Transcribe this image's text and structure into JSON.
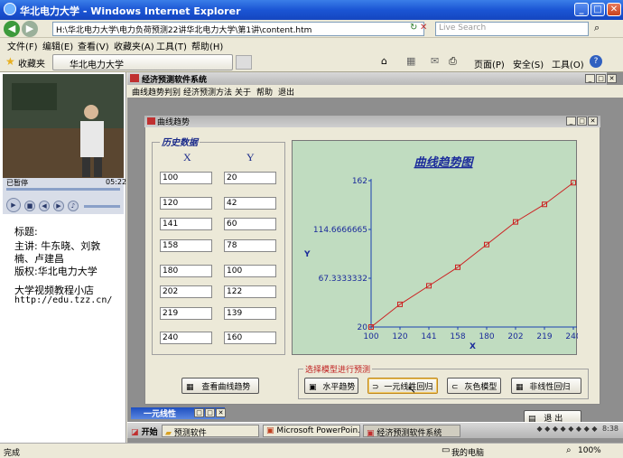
{
  "ie": {
    "title": "华北电力大学 - Windows Internet Explorer",
    "address": "H:\\华北电力大学\\电力负荷预测22讲华北电力大学\\第1讲\\content.htm",
    "search_placeholder": "Live Search",
    "menu": [
      "文件(F)",
      "编辑(E)",
      "查看(V)",
      "收藏夹(A)",
      "工具(T)",
      "帮助(H)"
    ],
    "favorites_label": "收藏夹",
    "tab_label": "华北电力大学",
    "toolbar_right": [
      "页面(P)",
      "安全(S)",
      "工具(O)"
    ],
    "status_left": "完成",
    "status_zone": "我的电脑",
    "zoom": "100%"
  },
  "left": {
    "player_status": "已暂停",
    "player_time": "05:22",
    "title_label": "标题:",
    "speaker_line1": "主讲: 牛东晓、刘敦",
    "speaker_line2": "楠、卢建昌",
    "copyright": "版权:华北电力大学",
    "shop_name": "大学视频教程小店",
    "shop_url": "http://edu.tzz.cn/"
  },
  "app": {
    "title": "经济预测软件系统",
    "menu": [
      "曲线趋势判别",
      "经济预测方法",
      "关于",
      "帮助",
      "退出"
    ],
    "dialog_title": "曲线趋势",
    "history_label": "历史数据",
    "x_header": "X",
    "y_header": "Y",
    "x_values": [
      "100",
      "120",
      "141",
      "158",
      "180",
      "202",
      "219",
      "240"
    ],
    "y_values": [
      "20",
      "42",
      "60",
      "78",
      "100",
      "122",
      "139",
      "160"
    ],
    "view_button": "查看曲线趋势",
    "group_label": "选择模型进行预测",
    "model_buttons": [
      "水平趋势",
      "一元线性回归",
      "灰色模型",
      "非线性回归"
    ],
    "exit_button": "退 出",
    "mini_window_title": "一元线性"
  },
  "taskbar": {
    "start": "开始",
    "tasks": [
      "预测软件",
      "Microsoft PowerPoin...",
      "经济预测软件系统"
    ],
    "clock": "8:38"
  },
  "chart_data": {
    "type": "line",
    "title": "曲线趋势图",
    "xlabel": "X",
    "ylabel": "Y",
    "x": [
      100,
      120,
      141,
      158,
      180,
      202,
      219,
      240
    ],
    "y": [
      20,
      42,
      60,
      78,
      100,
      122,
      139,
      160
    ],
    "ytick_labels": [
      "20",
      "67.3333332",
      "114.6666665",
      "162"
    ],
    "yticks": [
      20,
      67.3333332,
      114.6666665,
      162
    ],
    "xtick_labels": [
      "100",
      "120",
      "141",
      "158",
      "180",
      "202",
      "219",
      "240"
    ],
    "xlim": [
      100,
      240
    ],
    "ylim": [
      20,
      162
    ],
    "colors": {
      "line": "#cc2222",
      "axis": "#1a3fb0",
      "background": "#c0dcc0"
    }
  }
}
